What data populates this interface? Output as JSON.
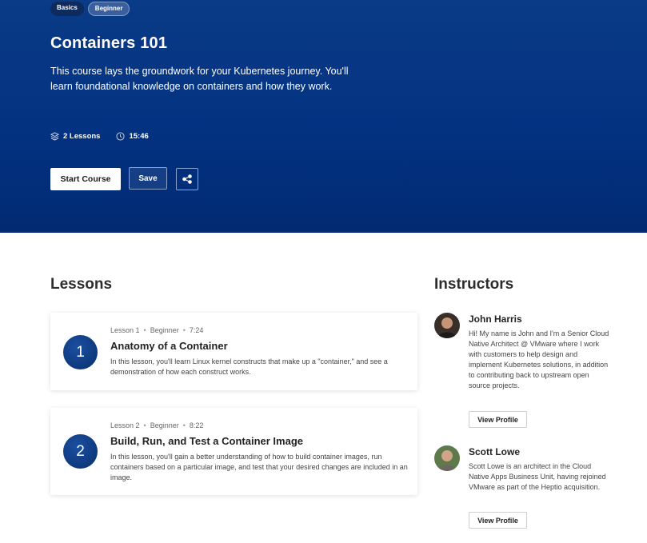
{
  "hero": {
    "tags": [
      "Basics",
      "Beginner"
    ],
    "title": "Containers 101",
    "description": "This course lays the groundwork for your Kubernetes journey. You'll learn foundational knowledge on containers and how they work.",
    "lessons_count": "2 Lessons",
    "duration": "15:46",
    "start_label": "Start Course",
    "save_label": "Save",
    "share_icon": "share-icon"
  },
  "lessons": {
    "heading": "Lessons",
    "items": [
      {
        "number": "1",
        "label": "Lesson 1",
        "level": "Beginner",
        "duration": "7:24",
        "title": "Anatomy of a Container",
        "description": "In this lesson, you'll learn Linux kernel constructs that make up a \"container,\" and see a demonstration of how each construct works."
      },
      {
        "number": "2",
        "label": "Lesson 2",
        "level": "Beginner",
        "duration": "8:22",
        "title": "Build, Run, and Test a Container Image",
        "description": "In this lesson, you'll gain a better understanding of how to build container images, run containers based on a particular image, and test that your desired changes are included in an image."
      }
    ]
  },
  "instructors": {
    "heading": "Instructors",
    "items": [
      {
        "name": "John Harris",
        "bio": "Hi! My name is John and I'm a Senior Cloud Native Architect @ VMware where I work with customers to help design and implement Kubernetes solutions, in addition to contributing back to upstream open source projects.",
        "button": "View Profile"
      },
      {
        "name": "Scott Lowe",
        "bio": "Scott Lowe is an architect in the Cloud Native Apps Business Unit, having rejoined VMware as part of the Heptio acquisition.",
        "button": "View Profile"
      }
    ]
  },
  "colors": {
    "hero_bg": "#033282",
    "accent": "#0a2f6e"
  }
}
